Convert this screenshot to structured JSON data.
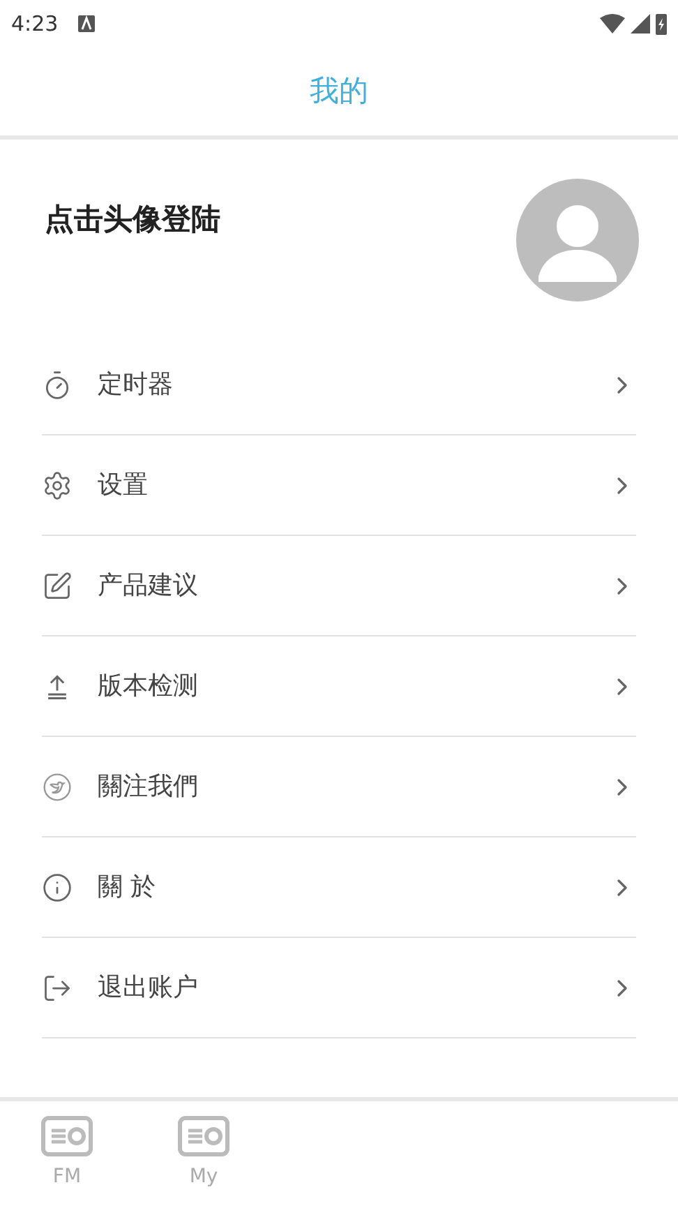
{
  "status_bar": {
    "time": "4:23"
  },
  "header": {
    "title": "我的"
  },
  "profile": {
    "login_prompt": "点击头像登陆"
  },
  "menu": [
    {
      "label": "定时器"
    },
    {
      "label": "设置"
    },
    {
      "label": "产品建议"
    },
    {
      "label": "版本检测"
    },
    {
      "label": "關注我們"
    },
    {
      "label": "關 於"
    },
    {
      "label": "退出账户"
    }
  ],
  "tab_bar": [
    {
      "label": "FM"
    },
    {
      "label": "My"
    }
  ]
}
